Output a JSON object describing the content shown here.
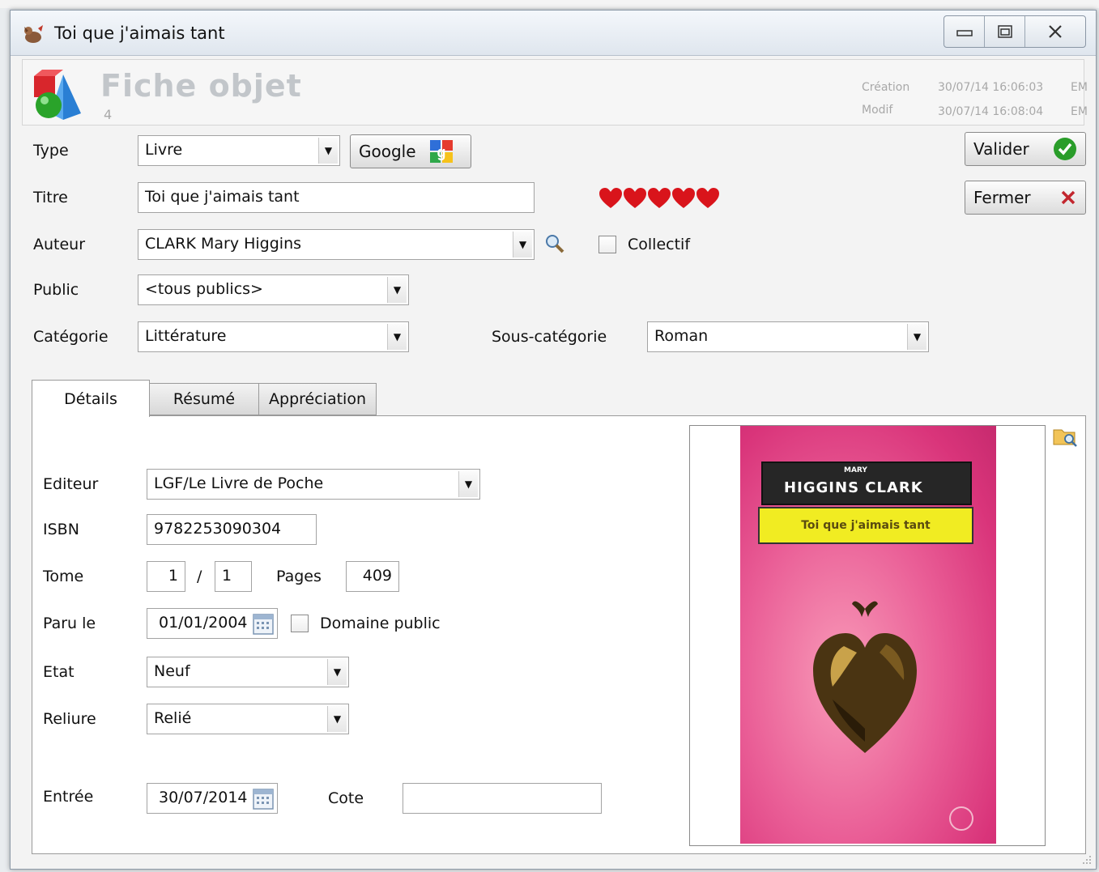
{
  "window": {
    "title": "Toi que j'aimais tant"
  },
  "header": {
    "title": "Fiche objet",
    "number": "4",
    "creation_label": "Création",
    "creation_value": "30/07/14 16:06:03",
    "creation_user": "EM",
    "modif_label": "Modif",
    "modif_value": "30/07/14 16:08:04",
    "modif_user": "EM"
  },
  "form": {
    "type_label": "Type",
    "type_value": "Livre",
    "google_label": "Google",
    "titre_label": "Titre",
    "titre_value": "Toi que j'aimais tant",
    "rating": 5,
    "auteur_label": "Auteur",
    "auteur_value": "CLARK Mary Higgins",
    "collectif_label": "Collectif",
    "collectif_checked": false,
    "public_label": "Public",
    "public_value": "<tous publics>",
    "categorie_label": "Catégorie",
    "categorie_value": "Littérature",
    "sous_categorie_label": "Sous-catégorie",
    "sous_categorie_value": "Roman"
  },
  "actions": {
    "valider_label": "Valider",
    "fermer_label": "Fermer"
  },
  "tabs": [
    {
      "label": "Détails",
      "active": true
    },
    {
      "label": "Résumé",
      "active": false
    },
    {
      "label": "Appréciation",
      "active": false
    }
  ],
  "details": {
    "editeur_label": "Editeur",
    "editeur_value": "LGF/Le Livre de Poche",
    "isbn_label": "ISBN",
    "isbn_value": "9782253090304",
    "tome_label": "Tome",
    "tome_value": "1",
    "tome_sep": "/",
    "tome_total": "1",
    "pages_label": "Pages",
    "pages_value": "409",
    "paru_label": "Paru le",
    "paru_value": "01/01/2004",
    "domaine_public_label": "Domaine public",
    "domaine_public_checked": false,
    "etat_label": "Etat",
    "etat_value": "Neuf",
    "reliure_label": "Reliure",
    "reliure_value": "Relié",
    "entree_label": "Entrée",
    "entree_value": "30/07/2014",
    "cote_label": "Cote",
    "cote_value": ""
  },
  "cover": {
    "author_small": "MARY",
    "author_big": "HIGGINS CLARK",
    "title": "Toi que j'aimais tant"
  },
  "colors": {
    "heart": "#d9141b",
    "valider_check": "#2a9d2a",
    "fermer_x": "#c2262e",
    "cover_pink": "#e3508c",
    "cover_yellow": "#f1ec22"
  }
}
